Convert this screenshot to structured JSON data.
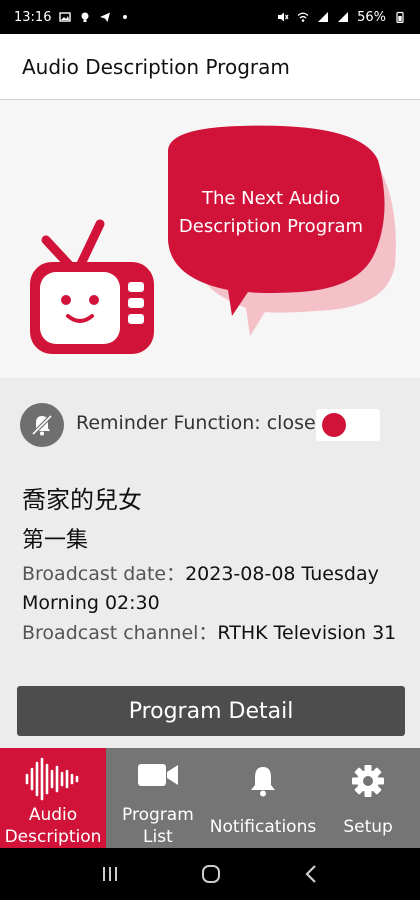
{
  "status_bar": {
    "time": "13:16",
    "battery": "56%"
  },
  "header": {
    "title": "Audio Description Program"
  },
  "hero": {
    "bubble_line1": "The Next Audio",
    "bubble_line2": "Description Program"
  },
  "reminder": {
    "label": "Reminder Function: close",
    "toggle_state": "off"
  },
  "program": {
    "title": "喬家的兒女",
    "episode": "第一集",
    "broadcast_date_label": "Broadcast date：",
    "broadcast_date_value": "2023-08-08 Tuesday Morning 02:30",
    "broadcast_channel_label": "Broadcast channel：",
    "broadcast_channel_value": "RTHK Television 31",
    "detail_button": "Program Detail"
  },
  "tabs": [
    {
      "label": "Audio Description",
      "icon": "audio-wave-icon",
      "active": true
    },
    {
      "label": "Program List",
      "icon": "video-camera-icon",
      "active": false
    },
    {
      "label": "Notifications",
      "icon": "bell-icon",
      "active": false
    },
    {
      "label": "Setup",
      "icon": "gear-icon",
      "active": false
    }
  ],
  "colors": {
    "accent": "#d1133a",
    "tab_bg": "#757575",
    "button_bg": "#4d4d4d"
  }
}
